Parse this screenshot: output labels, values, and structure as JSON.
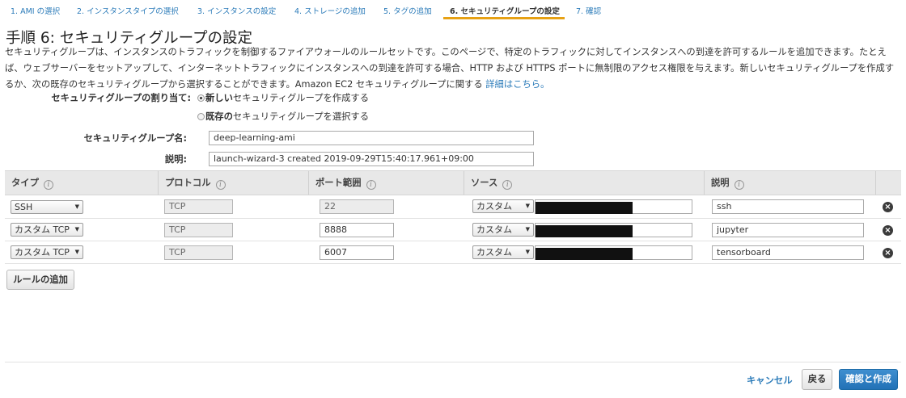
{
  "wizard": {
    "steps": [
      "1. AMI の選択",
      "2. インスタンスタイプの選択",
      "3. インスタンスの設定",
      "4. ストレージの追加",
      "5. タグの追加",
      "6. セキュリティグループの設定",
      "7. 確認"
    ],
    "active_step_index": 5
  },
  "page": {
    "title": "手順 6: セキュリティグループの設定",
    "description": "セキュリティグループは、インスタンスのトラフィックを制御するファイアウォールのルールセットです。このページで、特定のトラフィックに対してインスタンスへの到達を許可するルールを追加できます。たとえば、ウェブサーバーをセットアップして、インターネットトラフィックにインスタンスへの到達を許可する場合、HTTP および HTTPS ポートに無制限のアクセス権限を与えます。新しいセキュリティグループを作成するか、次の既存のセキュリティグループから選択することができます。Amazon EC2 セキュリティグループに関する",
    "details_link": "詳細はこちら。"
  },
  "assignment": {
    "label": "セキュリティグループの割り当て:",
    "option_new_bold": "新しい",
    "option_new_rest": "セキュリティグループを作成する",
    "option_existing_bold": "既存の",
    "option_existing_rest": "セキュリティグループを選択する",
    "selected": "new"
  },
  "group_name": {
    "label": "セキュリティグループ名:",
    "value": "deep-learning-ami"
  },
  "group_description": {
    "label": "説明:",
    "value": "launch-wizard-3 created 2019-09-29T15:40:17.961+09:00"
  },
  "table": {
    "headers": {
      "type": "タイプ",
      "protocol": "プロトコル",
      "port": "ポート範囲",
      "source": "ソース",
      "description": "説明"
    },
    "info_glyph": "i",
    "remove_glyph": "×",
    "rows": [
      {
        "type": "SSH",
        "protocol": "TCP",
        "port": "22",
        "source": "カスタム",
        "description": "ssh"
      },
      {
        "type": "カスタム TCP",
        "protocol": "TCP",
        "port": "8888",
        "source": "カスタム",
        "description": "jupyter"
      },
      {
        "type": "カスタム TCP",
        "protocol": "TCP",
        "port": "6007",
        "source": "カスタム",
        "description": "tensorboard"
      }
    ]
  },
  "add_rule_button": "ルールの追加",
  "footer": {
    "cancel": "キャンセル",
    "back": "戻る",
    "review_launch": "確認と作成"
  },
  "colors": {
    "link": "#2b7bb9",
    "active_tab_underline": "#e7a114",
    "primary_button": "#2271b6"
  }
}
